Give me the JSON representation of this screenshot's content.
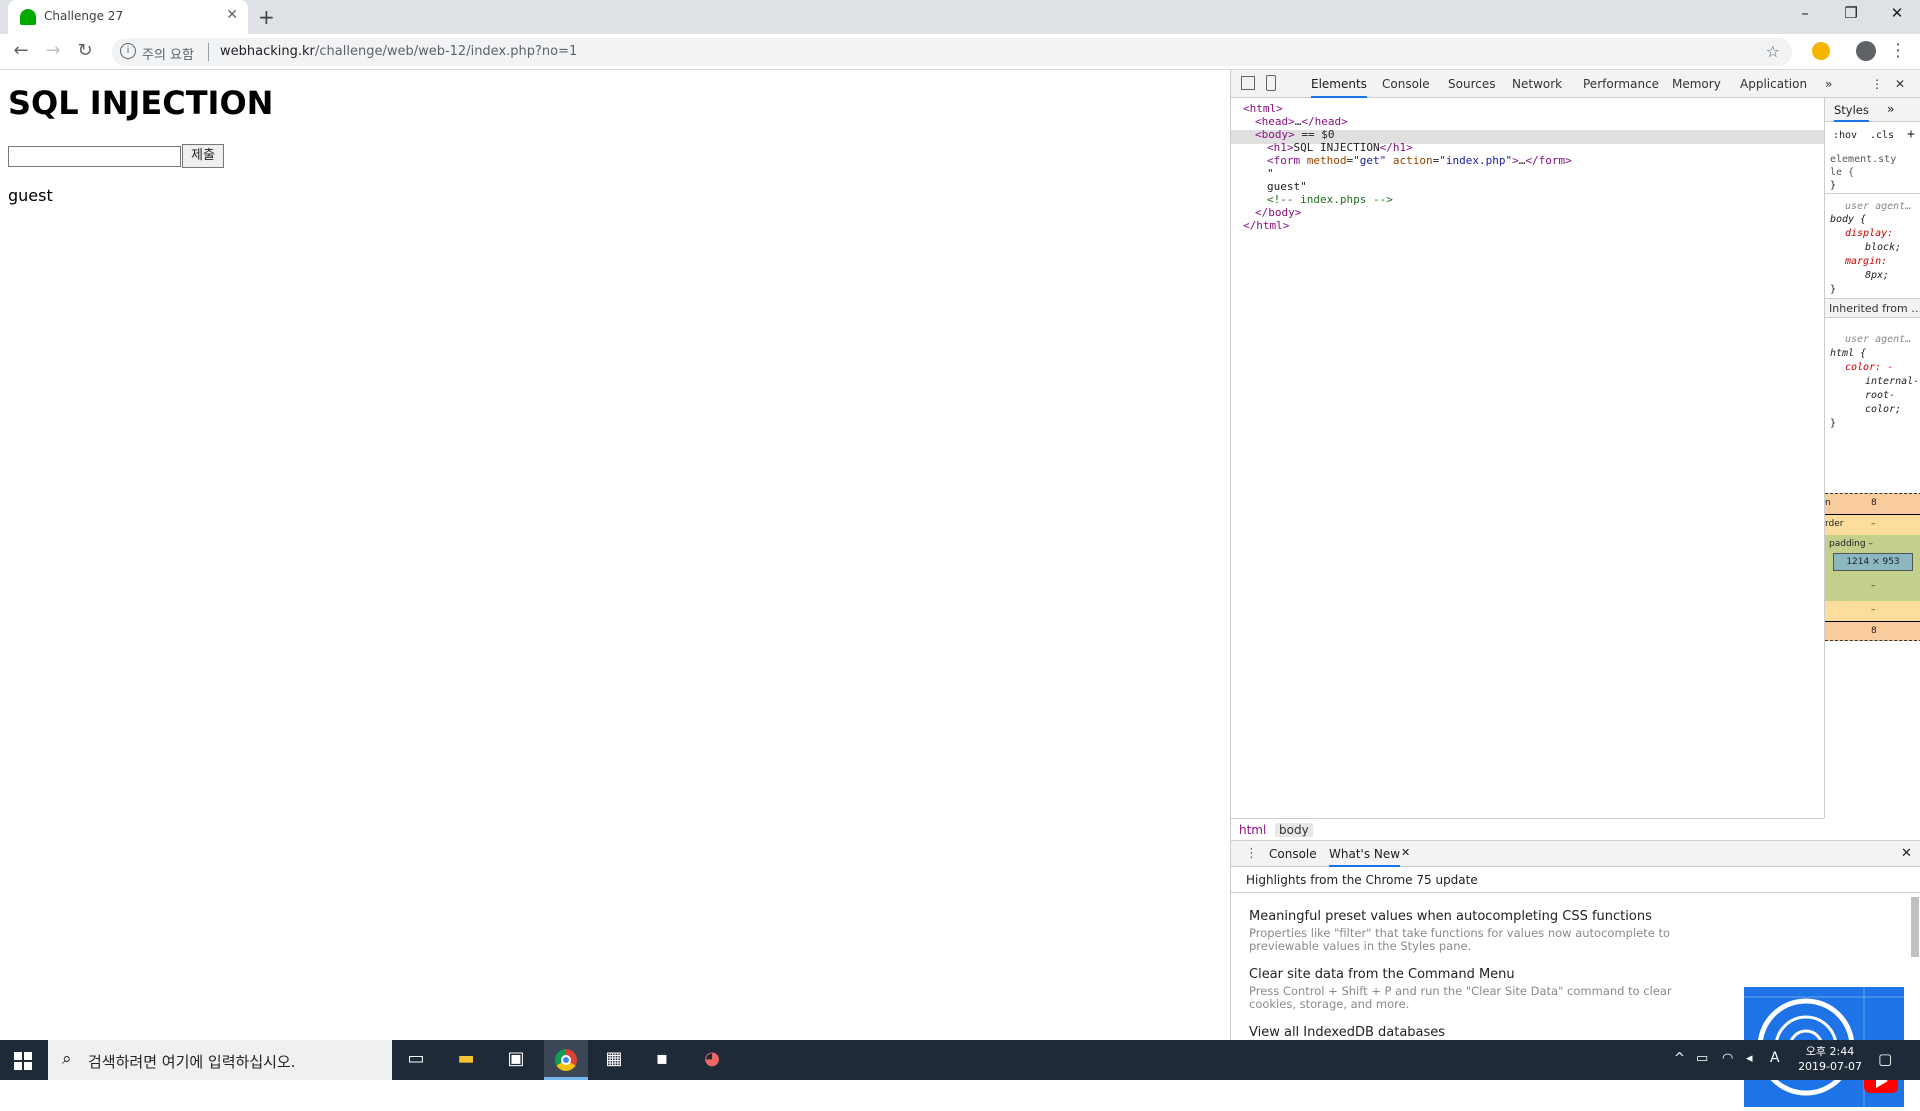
{
  "browser": {
    "tab_title": "Challenge 27",
    "new_tab_symbol": "+",
    "url_warning": "주의 요함",
    "url_host": "webhacking.kr",
    "url_path": "/challenge/web/web-12/index.php?no=1"
  },
  "page": {
    "heading": "SQL INJECTION",
    "input_value": "",
    "submit_label": "제출",
    "result_text": "guest"
  },
  "devtools": {
    "tabs": [
      "Elements",
      "Console",
      "Sources",
      "Network",
      "Performance",
      "Memory",
      "Application"
    ],
    "more_tabs": "»",
    "dom_lines": [
      {
        "indent": 0,
        "html": "<span class='tag'>&lt;html&gt;</span>"
      },
      {
        "indent": 1,
        "html": "<span class='tag'>&lt;head&gt;</span>…<span class='tag'>&lt;/head&gt;</span>"
      },
      {
        "indent": 1,
        "html": "<span class='tag'>&lt;body&gt;</span> == $0"
      },
      {
        "indent": 2,
        "html": "<span class='tag'>&lt;h1&gt;</span>SQL INJECTION<span class='tag'>&lt;/h1&gt;</span>"
      },
      {
        "indent": 2,
        "html": "<span class='tag'>&lt;form</span> <span class='attr'>method</span>=<span class='val'>\"get\"</span> <span class='attr'>action</span>=<span class='val'>\"index.php\"</span><span class='tag'>&gt;</span>…<span class='tag'>&lt;/form&gt;</span>"
      },
      {
        "indent": 2,
        "html": "\""
      },
      {
        "indent": 2,
        "html": "guest\""
      },
      {
        "indent": 2,
        "html": "<span class='cmt'>&lt;!-- index.phps --&gt;</span>"
      },
      {
        "indent": 1,
        "html": "<span class='tag'>&lt;/body&gt;</span>"
      },
      {
        "indent": 0,
        "html": "<span class='tag'>&lt;/html&gt;</span>"
      }
    ],
    "styles": {
      "tab": "Styles",
      "hov": ":hov",
      "cls": ".cls",
      "add": "+",
      "rule1_selector": "element.sty",
      "rule1_selector_2": "le {",
      "rule1_close": "}",
      "ua1": "user agent…",
      "sel_body": "body {",
      "p1": "display:",
      "v1": "block;",
      "p2": "margin:",
      "v2": "8px;",
      "close": "}",
      "inherited": "Inherited from …",
      "ua2": "user agent…",
      "sel_html": "html {",
      "p3": "color: -",
      "v3a": "internal-",
      "v3b": "root-",
      "v3c": "color;",
      "close2": "}",
      "box_margin_label": "n",
      "box_margin": "8",
      "box_border_label": "rder",
      "box_border": "–",
      "box_padding_label": "padding –",
      "box_size": "1214 × 953",
      "box_padding_bottom": "–",
      "box_border_bottom": "–",
      "box_margin_bottom": "8"
    },
    "crumbs": [
      "html",
      "body"
    ],
    "drawer": {
      "tabs": [
        "Console",
        "What's New"
      ],
      "header": "Highlights from the Chrome 75 update",
      "items": [
        {
          "title": "Meaningful preset values when autocompleting CSS functions",
          "desc": "Properties like \"filter\" that take functions for values now autocomplete to previewable values in the Styles pane."
        },
        {
          "title": "Clear site data from the Command Menu",
          "desc": "Press Control + Shift + P and run the \"Clear Site Data\" command to clear cookies, storage, and more."
        },
        {
          "title": "View all IndexedDB databases",
          "desc": ""
        }
      ]
    }
  },
  "taskbar": {
    "search_placeholder": "검색하려면 여기에 입력하십시오.",
    "time": "오후 2:44",
    "date": "2019-07-07",
    "ime": "A"
  }
}
